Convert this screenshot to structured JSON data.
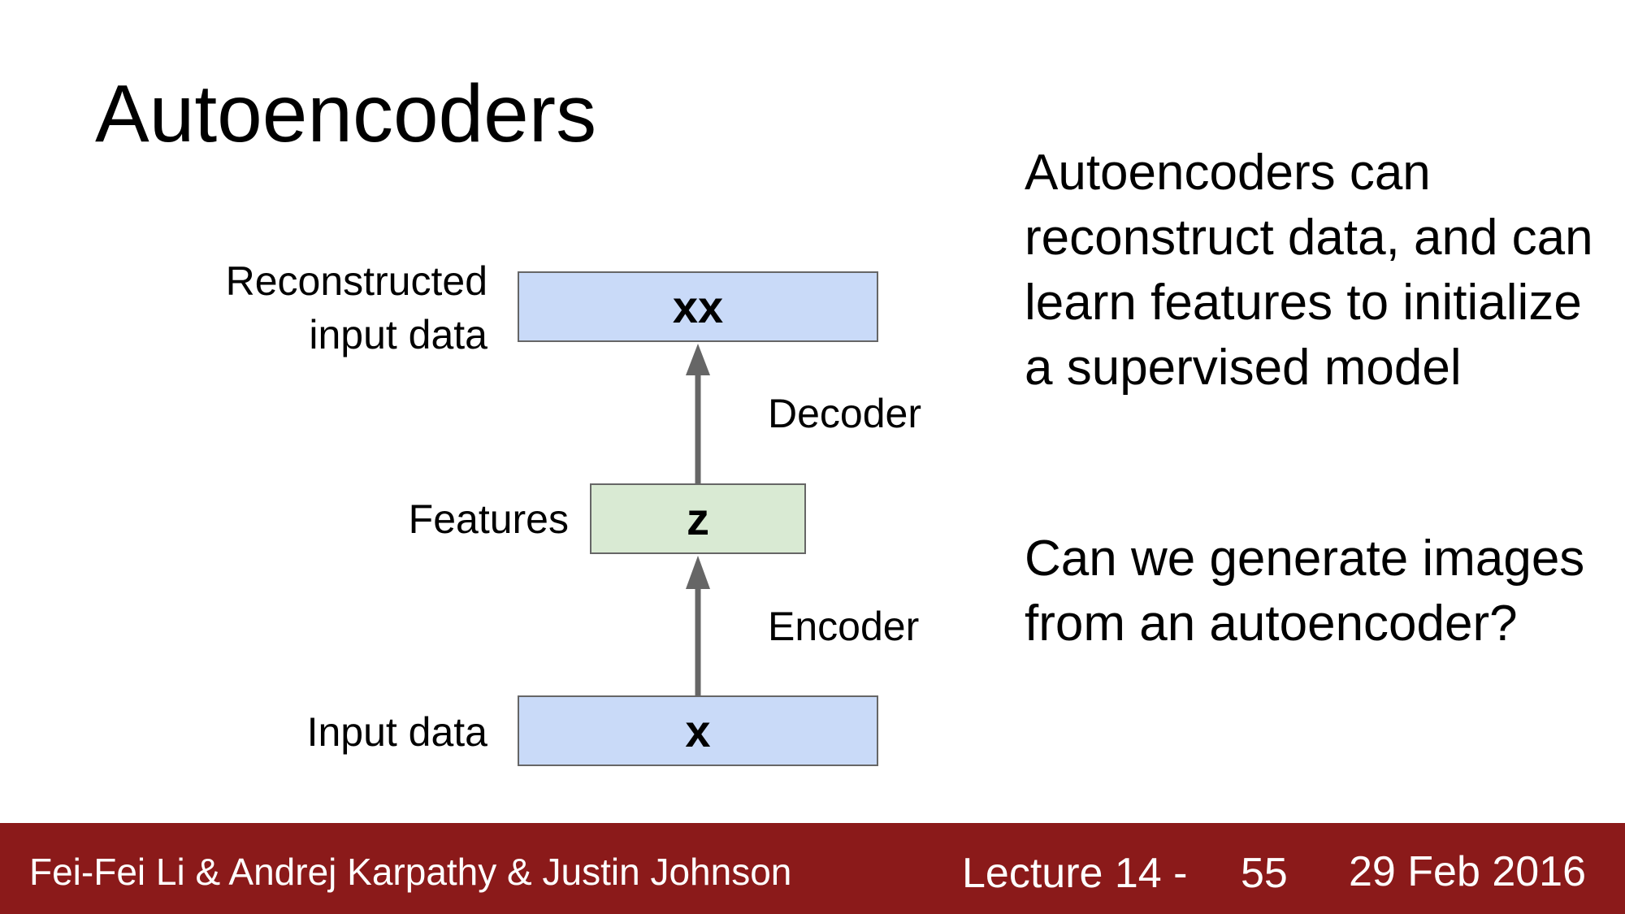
{
  "slide": {
    "title": "Autoencoders"
  },
  "diagram": {
    "top_box_text": "xx",
    "middle_box_text": "z",
    "bottom_box_text": "x",
    "label_reconstructed_line1": "Reconstructed",
    "label_reconstructed_line2": "input data",
    "label_features": "Features",
    "label_input": "Input data",
    "label_decoder": "Decoder",
    "label_encoder": "Encoder",
    "colors": {
      "data_box": "#c9daf8",
      "feature_box": "#d9ead3",
      "arrow": "#666666"
    }
  },
  "side_text": {
    "paragraph1": "Autoencoders can reconstruct data, and can learn features to initialize a supervised model",
    "paragraph2": "Can we generate images from an autoencoder?"
  },
  "footer": {
    "authors": "Fei-Fei Li & Andrej Karpathy & Justin Johnson",
    "lecture": "Lecture 14 -",
    "page": "55",
    "date": "29 Feb 2016",
    "color": "#8b1a1a"
  }
}
